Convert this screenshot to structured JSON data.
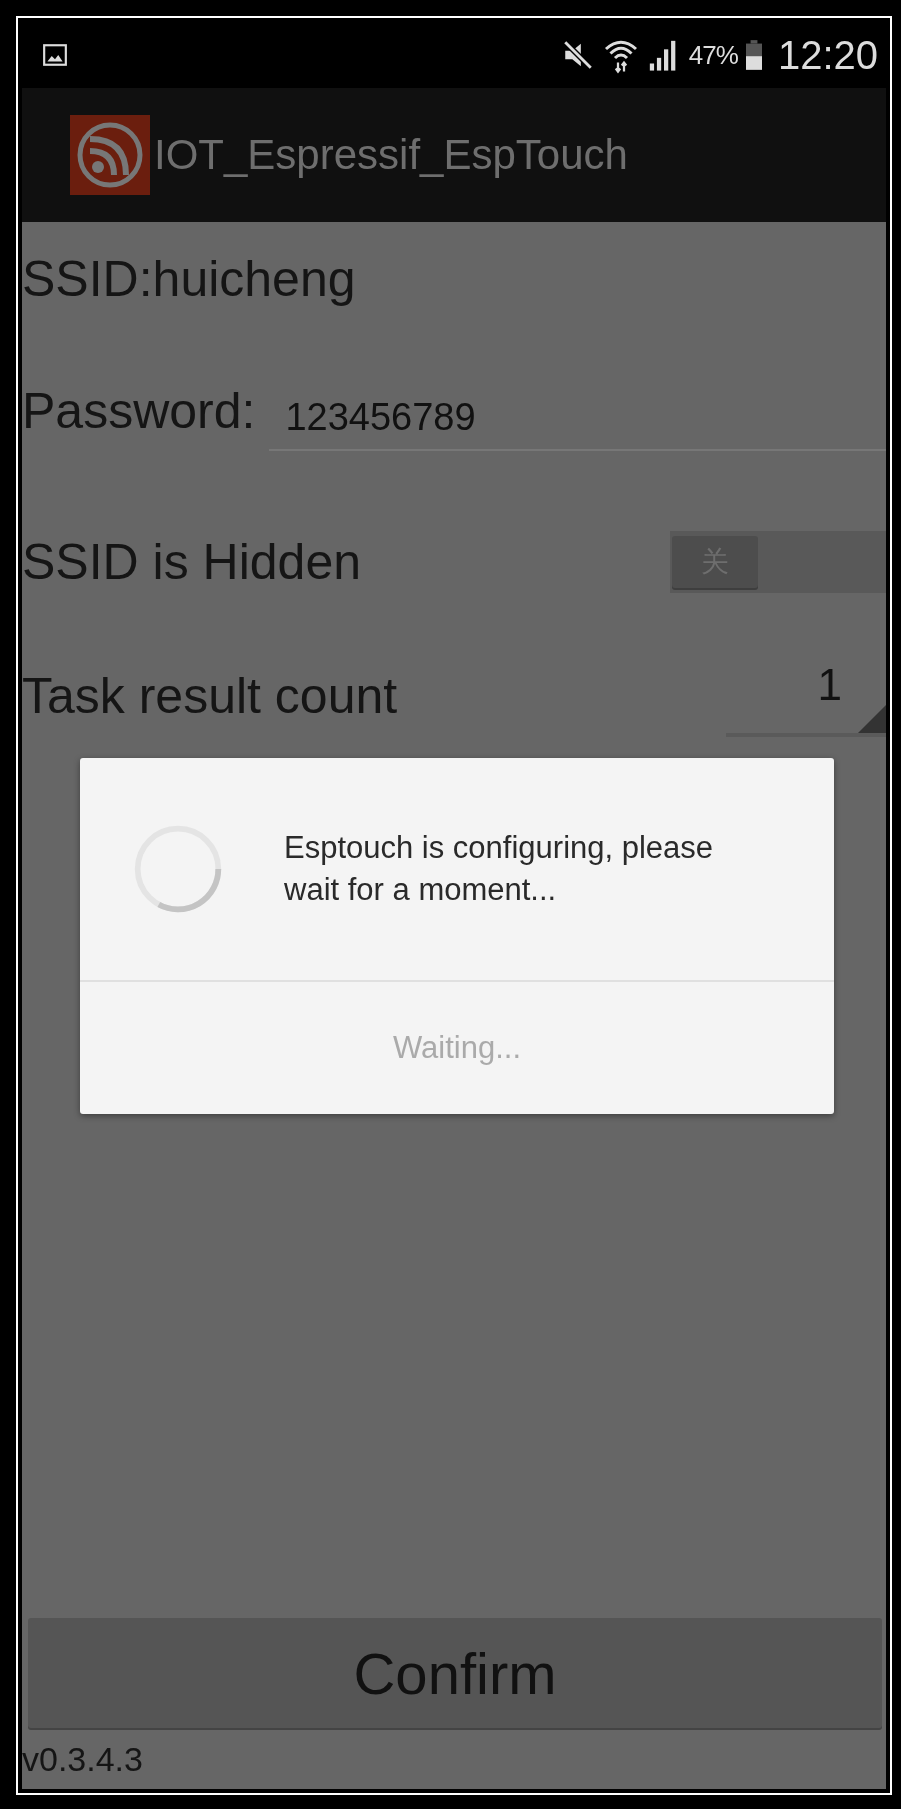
{
  "status_bar": {
    "battery_text": "47%",
    "time": "12:20"
  },
  "app_bar": {
    "title": "IOT_Espressif_EspTouch"
  },
  "ssid": "SSID:huicheng",
  "password": {
    "label": "Password:",
    "value": "123456789"
  },
  "hidden_ssid": {
    "label": "SSID is Hidden",
    "toggle": {
      "on": false,
      "text": "关"
    }
  },
  "task_count": {
    "label": "Task result count",
    "value": "1"
  },
  "dialog": {
    "message": "Esptouch is configuring, please wait for a moment...",
    "button": "Waiting..."
  },
  "confirm": "Confirm",
  "version": "v0.3.4.3"
}
